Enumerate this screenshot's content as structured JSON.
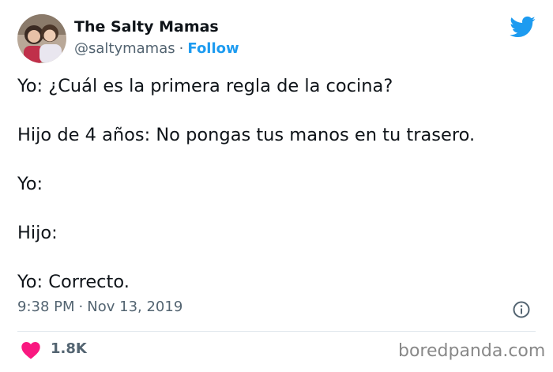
{
  "author": {
    "name": "The Salty Mamas",
    "handle": "@saltymamas",
    "separator": "·",
    "follow_label": "Follow"
  },
  "tweet": {
    "lines": [
      "Yo: ¿Cuál es la primera regla de la cocina?",
      "Hijo de 4 años: No pongas tus manos en tu trasero.",
      "Yo:",
      "Hijo:",
      "Yo: Correcto."
    ],
    "time": "9:38 PM",
    "separator": "·",
    "date": "Nov 13, 2019"
  },
  "engagement": {
    "likes": "1.8K"
  },
  "watermark": "boredpanda.com",
  "icons": {
    "brand": "twitter-bird-icon",
    "info": "info-icon",
    "like": "heart-icon"
  },
  "colors": {
    "accent": "#1d9bf0",
    "heart": "#f91880",
    "muted": "#536471",
    "text": "#0f1419"
  }
}
